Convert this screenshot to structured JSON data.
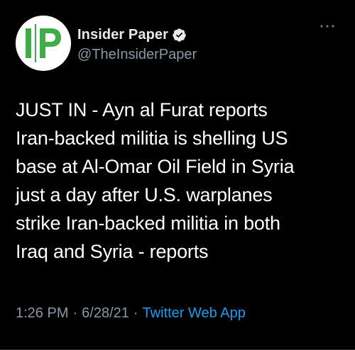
{
  "tweet": {
    "author": {
      "avatar_text": "IP",
      "display_name": "Insider Paper",
      "handle": "@TheInsiderPaper",
      "verified": true,
      "verified_icon": "verified-badge-icon"
    },
    "more_icon": "ellipsis-icon",
    "text": "JUST IN - Ayn al Furat reports\nIran-backed militia is shelling US\nbase at Al-Omar Oil Field in Syria\njust a day after U.S. warplanes\nstrike Iran-backed militia in both\nIraq and Syria - reports",
    "time": "1:26 PM",
    "date": "6/28/21",
    "separator": "·",
    "source": "Twitter Web App"
  },
  "colors": {
    "background": "#000000",
    "text": "#ffffff",
    "secondary": "#8b98a5",
    "link": "#1d9bf0",
    "logo_green": "#3fae49"
  }
}
